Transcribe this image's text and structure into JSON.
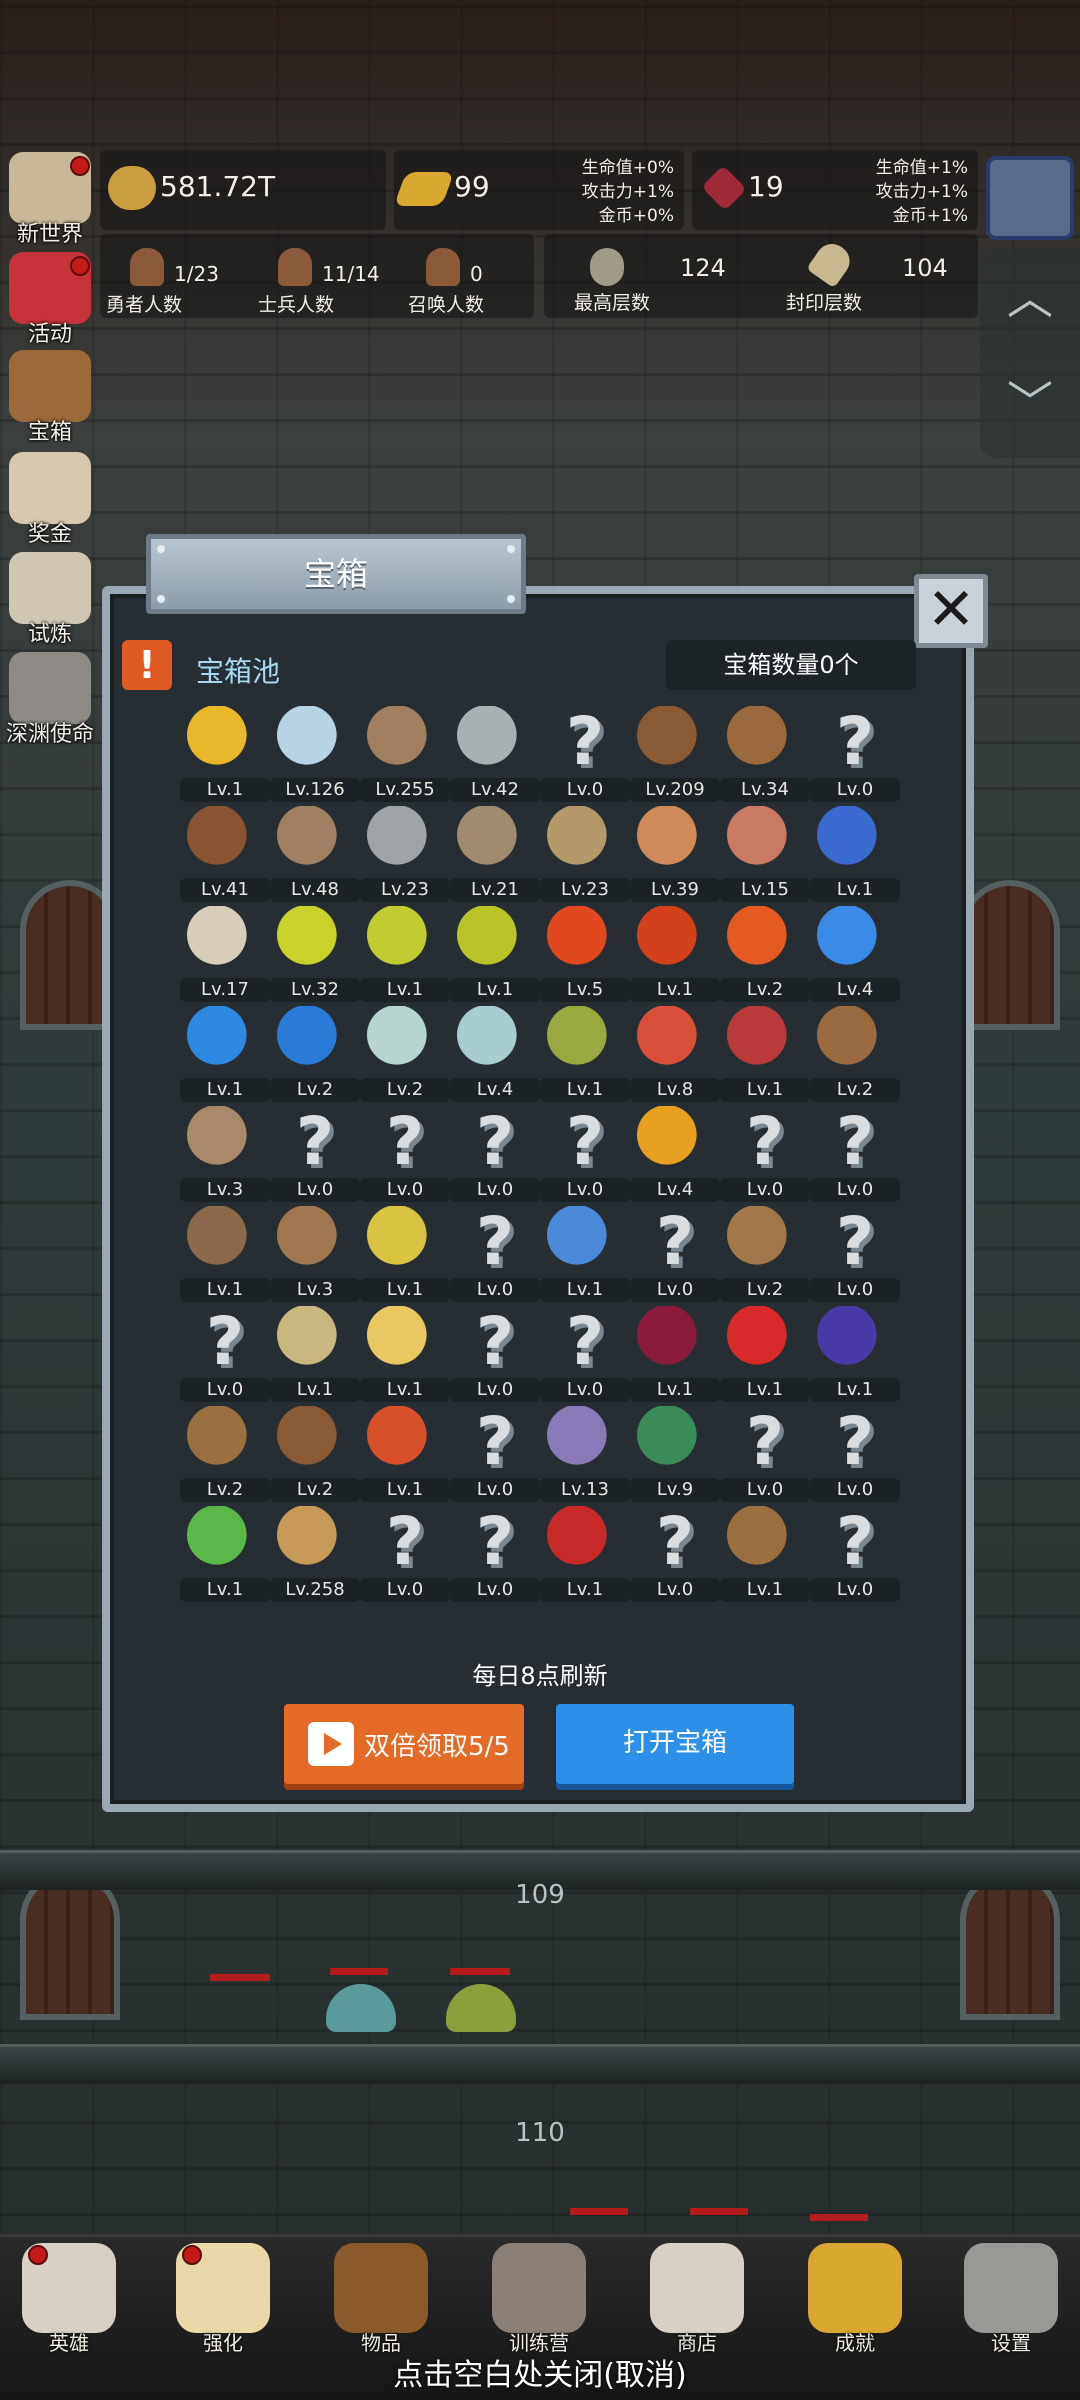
{
  "side_menu": [
    {
      "label": "新世界",
      "icon": "scroll-map-icon",
      "color": "#c9b79a",
      "badge": true
    },
    {
      "label": "活动",
      "icon": "heart-icon",
      "color": "#c8323a",
      "badge": true
    },
    {
      "label": "宝箱",
      "icon": "chest-icon",
      "color": "#9a6a3a",
      "badge": false
    },
    {
      "label": "奖金",
      "icon": "envelope-icon",
      "color": "#d8c8b0",
      "badge": false
    },
    {
      "label": "试炼",
      "icon": "feather-icon",
      "color": "#cfc6b4",
      "badge": false
    },
    {
      "label": "深渊使命",
      "icon": "orb-icon",
      "color": "#8e8a86",
      "badge": false
    }
  ],
  "resources": {
    "gold": {
      "value": "581.72T",
      "icon": "gold-coin-icon"
    },
    "ingot": {
      "value": "99",
      "icon": "gold-bar-icon",
      "bonus": [
        "生命值+0%",
        "攻击力+1%",
        "金币+0%"
      ]
    },
    "gem": {
      "value": "19",
      "icon": "red-gem-icon",
      "bonus": [
        "生命值+1%",
        "攻击力+1%",
        "金币+1%"
      ]
    }
  },
  "stats": {
    "heroes": {
      "value": "1/23",
      "label": "勇者人数"
    },
    "soldiers": {
      "value": "11/14",
      "label": "士兵人数"
    },
    "summons": {
      "value": "0",
      "label": "召唤人数"
    },
    "max_floor": {
      "value": "124",
      "label": "最高层数"
    },
    "seal_floor": {
      "value": "104",
      "label": "封印层数"
    }
  },
  "modal": {
    "title": "宝箱",
    "pool_label": "宝箱池",
    "chest_count": "宝箱数量0个",
    "refresh_note": "每日8点刷新",
    "double_button": "双倍领取5/5",
    "open_button": "打开宝箱",
    "items": [
      {
        "icon": "crown-icon",
        "level": "Lv.1",
        "color": "#e8b82a"
      },
      {
        "icon": "diamond-icon",
        "level": "Lv.126",
        "color": "#b8d4e4"
      },
      {
        "icon": "sword-icon",
        "level": "Lv.255",
        "color": "#a08060"
      },
      {
        "icon": "sword-icon",
        "level": "Lv.42",
        "color": "#a8b0b4"
      },
      {
        "icon": "unknown-icon",
        "level": "Lv.0",
        "color": ""
      },
      {
        "icon": "backpack-icon",
        "level": "Lv.209",
        "color": "#8a5a34"
      },
      {
        "icon": "backpack-icon",
        "level": "Lv.34",
        "color": "#9a6a3e"
      },
      {
        "icon": "unknown-icon",
        "level": "Lv.0",
        "color": ""
      },
      {
        "icon": "leather-hood-icon",
        "level": "Lv.41",
        "color": "#8a5432"
      },
      {
        "icon": "dagger-icon",
        "level": "Lv.48",
        "color": "#a08062"
      },
      {
        "icon": "knight-helmet-icon",
        "level": "Lv.23",
        "color": "#9ea4a8"
      },
      {
        "icon": "hammer-icon",
        "level": "Lv.21",
        "color": "#a08a70"
      },
      {
        "icon": "great-helm-icon",
        "level": "Lv.23",
        "color": "#b49a6a"
      },
      {
        "icon": "ham-icon",
        "level": "Lv.39",
        "color": "#d08a5a"
      },
      {
        "icon": "steak-icon",
        "level": "Lv.15",
        "color": "#c87a62"
      },
      {
        "icon": "blue-pouch-icon",
        "level": "Lv.1",
        "color": "#3a6ad0"
      },
      {
        "icon": "flour-bowl-icon",
        "level": "Lv.17",
        "color": "#d8ccba"
      },
      {
        "icon": "yellow-potion-icon",
        "level": "Lv.32",
        "color": "#c8d22a"
      },
      {
        "icon": "yellow-potion-icon",
        "level": "Lv.1",
        "color": "#c0cc30"
      },
      {
        "icon": "yellow-potion-icon",
        "level": "Lv.1",
        "color": "#b8c428"
      },
      {
        "icon": "red-potion-icon",
        "level": "Lv.5",
        "color": "#e2481e"
      },
      {
        "icon": "red-potion-icon",
        "level": "Lv.1",
        "color": "#d4401c"
      },
      {
        "icon": "red-potion-icon",
        "level": "Lv.2",
        "color": "#e45a22"
      },
      {
        "icon": "blue-potion-icon",
        "level": "Lv.4",
        "color": "#3a8ae8"
      },
      {
        "icon": "blue-potion-icon",
        "level": "Lv.1",
        "color": "#2e8ae0"
      },
      {
        "icon": "blue-potion-icon",
        "level": "Lv.2",
        "color": "#2a7ad8"
      },
      {
        "icon": "empty-bottle-icon",
        "level": "Lv.2",
        "color": "#b8d4d0"
      },
      {
        "icon": "empty-bottle-icon",
        "level": "Lv.4",
        "color": "#a8ccd0"
      },
      {
        "icon": "green-bottle-icon",
        "level": "Lv.1",
        "color": "#9aa840"
      },
      {
        "icon": "red-bottle-icon",
        "level": "Lv.8",
        "color": "#d8503a"
      },
      {
        "icon": "winged-boot-icon",
        "level": "Lv.1",
        "color": "#b83a3a"
      },
      {
        "icon": "boot-icon",
        "level": "Lv.2",
        "color": "#9a6a40"
      },
      {
        "icon": "shoe-icon",
        "level": "Lv.3",
        "color": "#a88a6a"
      },
      {
        "icon": "unknown-icon",
        "level": "Lv.0",
        "color": ""
      },
      {
        "icon": "unknown-icon",
        "level": "Lv.0",
        "color": ""
      },
      {
        "icon": "unknown-icon",
        "level": "Lv.0",
        "color": ""
      },
      {
        "icon": "unknown-icon",
        "level": "Lv.0",
        "color": ""
      },
      {
        "icon": "torch-staff-icon",
        "level": "Lv.4",
        "color": "#e8a020"
      },
      {
        "icon": "unknown-icon",
        "level": "Lv.0",
        "color": ""
      },
      {
        "icon": "unknown-icon",
        "level": "Lv.0",
        "color": ""
      },
      {
        "icon": "pickaxe-icon",
        "level": "Lv.1",
        "color": "#8a6a4a"
      },
      {
        "icon": "cane-icon",
        "level": "Lv.3",
        "color": "#a07850"
      },
      {
        "icon": "lemon-icon",
        "level": "Lv.1",
        "color": "#d8c440"
      },
      {
        "icon": "unknown-icon",
        "level": "Lv.0",
        "color": ""
      },
      {
        "icon": "blue-scepter-icon",
        "level": "Lv.1",
        "color": "#4a8ad8"
      },
      {
        "icon": "unknown-icon",
        "level": "Lv.0",
        "color": ""
      },
      {
        "icon": "backpack-icon",
        "level": "Lv.2",
        "color": "#a0784a"
      },
      {
        "icon": "unknown-icon",
        "level": "Lv.0",
        "color": ""
      },
      {
        "icon": "unknown-icon",
        "level": "Lv.0",
        "color": ""
      },
      {
        "icon": "spiked-club-icon",
        "level": "Lv.1",
        "color": "#c8b880"
      },
      {
        "icon": "cheese-icon",
        "level": "Lv.1",
        "color": "#e8c860"
      },
      {
        "icon": "unknown-icon",
        "level": "Lv.0",
        "color": ""
      },
      {
        "icon": "unknown-icon",
        "level": "Lv.0",
        "color": ""
      },
      {
        "icon": "red-crystal-icon",
        "level": "Lv.1",
        "color": "#8a1a3a"
      },
      {
        "icon": "red-orb-icon",
        "level": "Lv.1",
        "color": "#d82a2a"
      },
      {
        "icon": "magic-cube-icon",
        "level": "Lv.1",
        "color": "#4a3aa8"
      },
      {
        "icon": "bow-icon",
        "level": "Lv.2",
        "color": "#9a7040"
      },
      {
        "icon": "quiver-icon",
        "level": "Lv.2",
        "color": "#8a5a34"
      },
      {
        "icon": "fire-gauntlet-icon",
        "level": "Lv.1",
        "color": "#d8502a"
      },
      {
        "icon": "unknown-icon",
        "level": "Lv.0",
        "color": ""
      },
      {
        "icon": "tentacle-icon",
        "level": "Lv.13",
        "color": "#8a7ab8"
      },
      {
        "icon": "green-emblem-icon",
        "level": "Lv.9",
        "color": "#3a8a5a"
      },
      {
        "icon": "unknown-icon",
        "level": "Lv.0",
        "color": ""
      },
      {
        "icon": "unknown-icon",
        "level": "Lv.0",
        "color": ""
      },
      {
        "icon": "green-wand-icon",
        "level": "Lv.1",
        "color": "#5ab84a"
      },
      {
        "icon": "beer-mug-icon",
        "level": "Lv.258",
        "color": "#c89a5a"
      },
      {
        "icon": "unknown-icon",
        "level": "Lv.0",
        "color": ""
      },
      {
        "icon": "unknown-icon",
        "level": "Lv.0",
        "color": ""
      },
      {
        "icon": "red-book-icon",
        "level": "Lv.1",
        "color": "#c82a2a"
      },
      {
        "icon": "unknown-icon",
        "level": "Lv.0",
        "color": ""
      },
      {
        "icon": "whip-icon",
        "level": "Lv.1",
        "color": "#9a7040"
      },
      {
        "icon": "unknown-icon",
        "level": "Lv.0",
        "color": ""
      }
    ]
  },
  "floors": [
    "109",
    "110"
  ],
  "bottom_nav": [
    {
      "label": "英雄",
      "icon": "skull-icon",
      "color": "#d8d0c4",
      "badge": true
    },
    {
      "label": "强化",
      "icon": "candle-icon",
      "color": "#e8d8a8",
      "badge": true
    },
    {
      "label": "物品",
      "icon": "book-icon",
      "color": "#8a5a2a",
      "badge": false
    },
    {
      "label": "训练营",
      "icon": "lantern-icon",
      "color": "#8a8078",
      "badge": false
    },
    {
      "label": "商店",
      "icon": "beer-mug-icon",
      "color": "#d8d0c4",
      "badge": false
    },
    {
      "label": "成就",
      "icon": "key-icon",
      "color": "#d8a830",
      "badge": false
    },
    {
      "label": "设置",
      "icon": "gear-icon",
      "color": "#9a9894",
      "badge": false
    }
  ],
  "dismiss_hint": "点击空白处关闭(取消)"
}
